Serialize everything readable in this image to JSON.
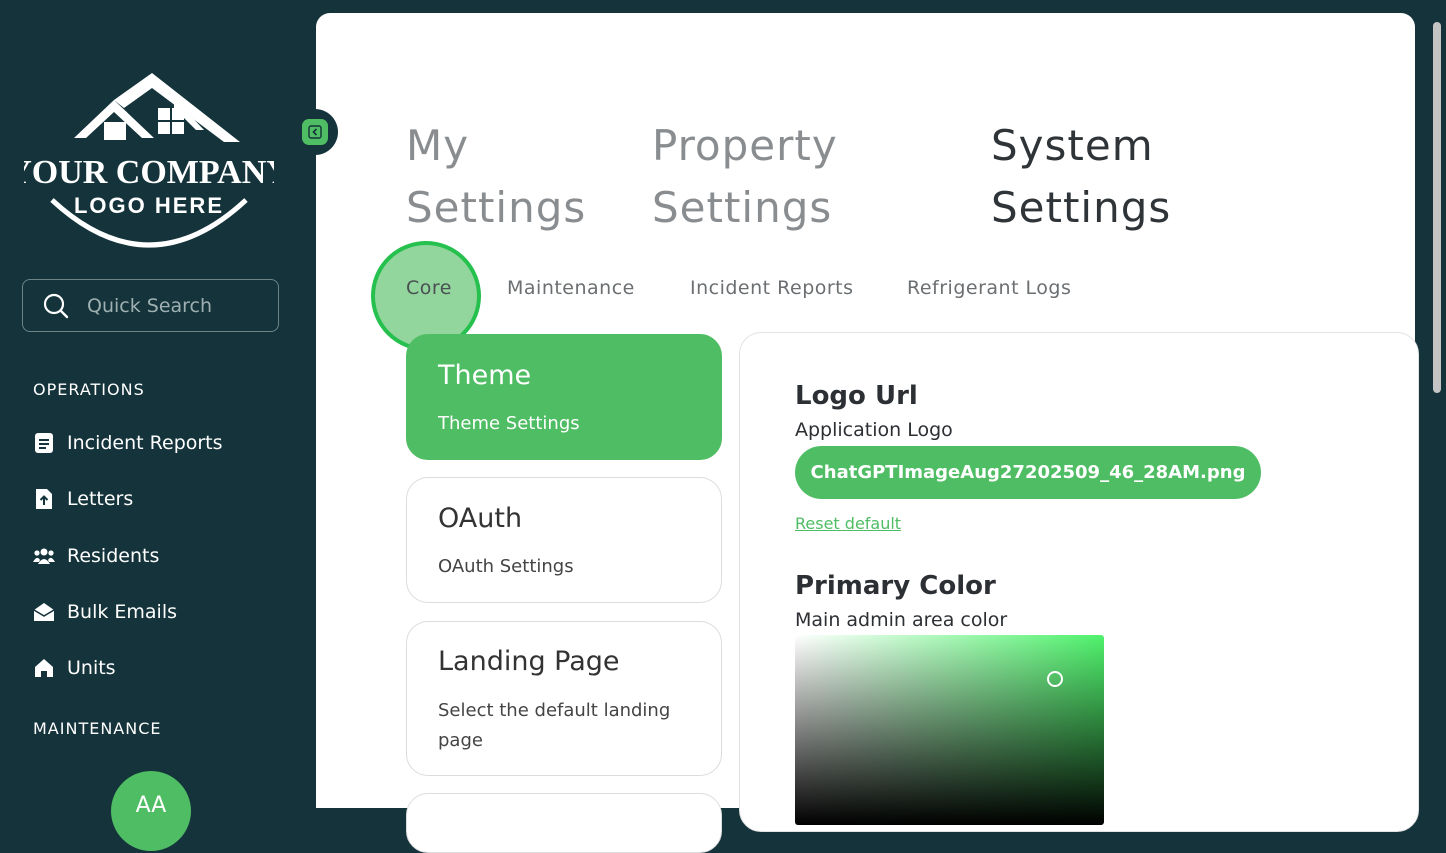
{
  "sidebar": {
    "logo": {
      "line1": "YOUR COMPANY",
      "line2": "LOGO HERE"
    },
    "search": {
      "placeholder": "Quick Search",
      "icon": "search-icon"
    },
    "sections": [
      {
        "label": "OPERATIONS",
        "items": [
          {
            "label": "Incident Reports",
            "icon": "document-icon"
          },
          {
            "label": "Letters",
            "icon": "file-upload-icon"
          },
          {
            "label": "Residents",
            "icon": "users-icon"
          },
          {
            "label": "Bulk Emails",
            "icon": "envelope-open-icon"
          },
          {
            "label": "Units",
            "icon": "home-icon"
          }
        ]
      },
      {
        "label": "MAINTENANCE",
        "items": []
      }
    ],
    "avatar": {
      "initials": "AA"
    },
    "collapse_icon": "chevron-left-icon"
  },
  "tabs": {
    "top": [
      {
        "line1": "My",
        "line2": "Settings",
        "active": false
      },
      {
        "line1": "Property",
        "line2": "Settings",
        "active": false
      },
      {
        "line1": "System",
        "line2": "Settings",
        "active": true
      }
    ],
    "sub": [
      {
        "label": "Core",
        "active": true
      },
      {
        "label": "Maintenance"
      },
      {
        "label": "Incident Reports"
      },
      {
        "label": "Refrigerant Logs"
      }
    ]
  },
  "cards": [
    {
      "title": "Theme",
      "desc": "Theme Settings",
      "active": true
    },
    {
      "title": "OAuth",
      "desc": "OAuth Settings",
      "active": false
    },
    {
      "title": "Landing Page",
      "desc": "Select the default landing page",
      "active": false
    }
  ],
  "theme_panel": {
    "logo_url": {
      "title": "Logo Url",
      "desc": "Application Logo",
      "file_name": "ChatGPTImageAug27202509_46_28AM.png",
      "reset_label": "Reset default"
    },
    "primary_color": {
      "title": "Primary Color",
      "desc": "Main admin area color"
    }
  },
  "colors": {
    "sidebar_bg": "#14333a",
    "accent": "#4fbd63",
    "active_tab_text": "#2f3438",
    "inactive_tab_text": "#6b6f72"
  }
}
